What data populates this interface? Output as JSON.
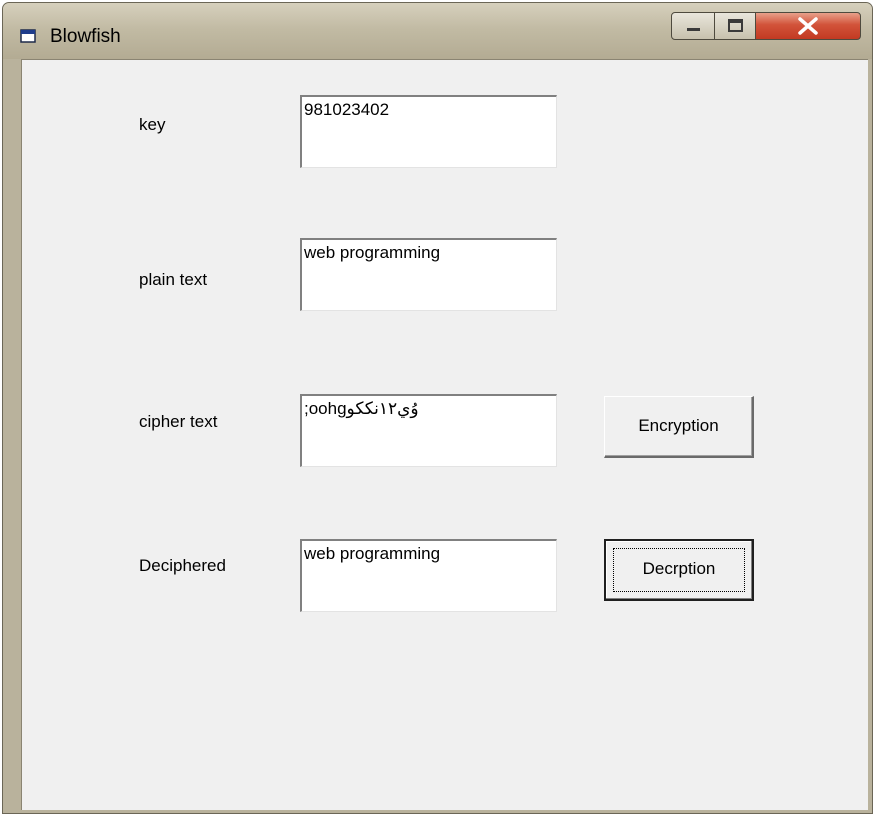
{
  "window": {
    "title": "Blowfish",
    "icon": "app-window-icon",
    "controls": [
      "minimize-icon",
      "maximize-icon",
      "close-icon"
    ]
  },
  "form": {
    "key": {
      "label": "key",
      "value": "981023402"
    },
    "plain_text": {
      "label": "plain text",
      "value": "web programming"
    },
    "cipher_text": {
      "label": "cipher text",
      "value": ";oohgوُي١٢نككو"
    },
    "deciphered": {
      "label": "Deciphered",
      "value": "web programming"
    }
  },
  "buttons": {
    "encrypt_label": "Encryption",
    "decrypt_label": "Decrption"
  }
}
